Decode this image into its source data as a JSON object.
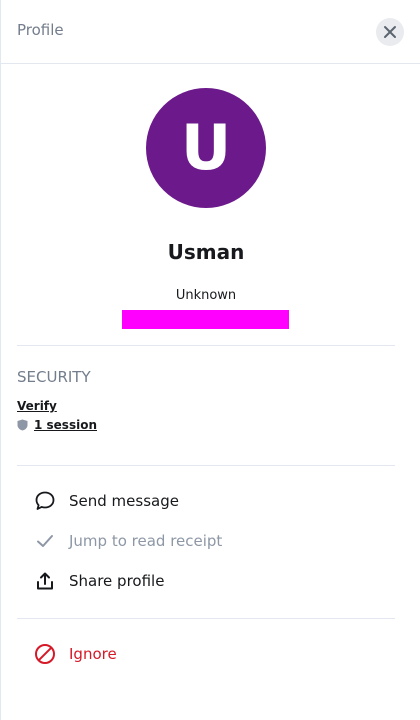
{
  "header": {
    "title": "Profile",
    "close_icon": "close-icon"
  },
  "user": {
    "avatar_letter": "U",
    "avatar_color": "#6c1a8b",
    "name": "Usman",
    "presence": "Unknown"
  },
  "highlight_color": "#ff00ff",
  "security": {
    "heading": "SECURITY",
    "verify_label": "Verify",
    "sessions_label": "1 session",
    "sessions_icon": "shield-icon"
  },
  "actions": [
    {
      "label": "Send message",
      "icon": "chat-bubble-icon",
      "enabled": true
    },
    {
      "label": "Jump to read receipt",
      "icon": "check-icon",
      "enabled": false
    },
    {
      "label": "Share profile",
      "icon": "share-icon",
      "enabled": true
    }
  ],
  "danger_action": {
    "label": "Ignore",
    "icon": "block-icon",
    "color": "#d51928"
  }
}
